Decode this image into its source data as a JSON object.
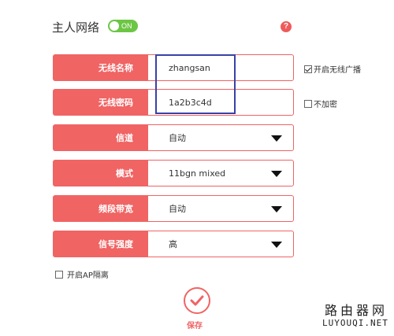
{
  "header": {
    "title": "主人网络",
    "toggle_label": "ON",
    "help_label": "?"
  },
  "form": {
    "ssid": {
      "label": "无线名称",
      "value": "zhangsan",
      "option_label": "开启无线广播",
      "option_checked": true
    },
    "password": {
      "label": "无线密码",
      "value": "1a2b3c4d",
      "option_label": "不加密",
      "option_checked": false
    },
    "channel": {
      "label": "信道",
      "value": "自动"
    },
    "mode": {
      "label": "模式",
      "value": "11bgn mixed"
    },
    "bandwidth": {
      "label": "频段带宽",
      "value": "自动"
    },
    "signal": {
      "label": "信号强度",
      "value": "高"
    },
    "ap_isolation": {
      "label": "开启AP隔离",
      "checked": false
    }
  },
  "actions": {
    "save_label": "保存"
  },
  "watermark": {
    "line1": "路由器网",
    "line2": "LUYOUQI.NET"
  },
  "colors": {
    "accent": "#f06464",
    "toggle_on": "#6cc644",
    "highlight_box": "#3742a8"
  }
}
